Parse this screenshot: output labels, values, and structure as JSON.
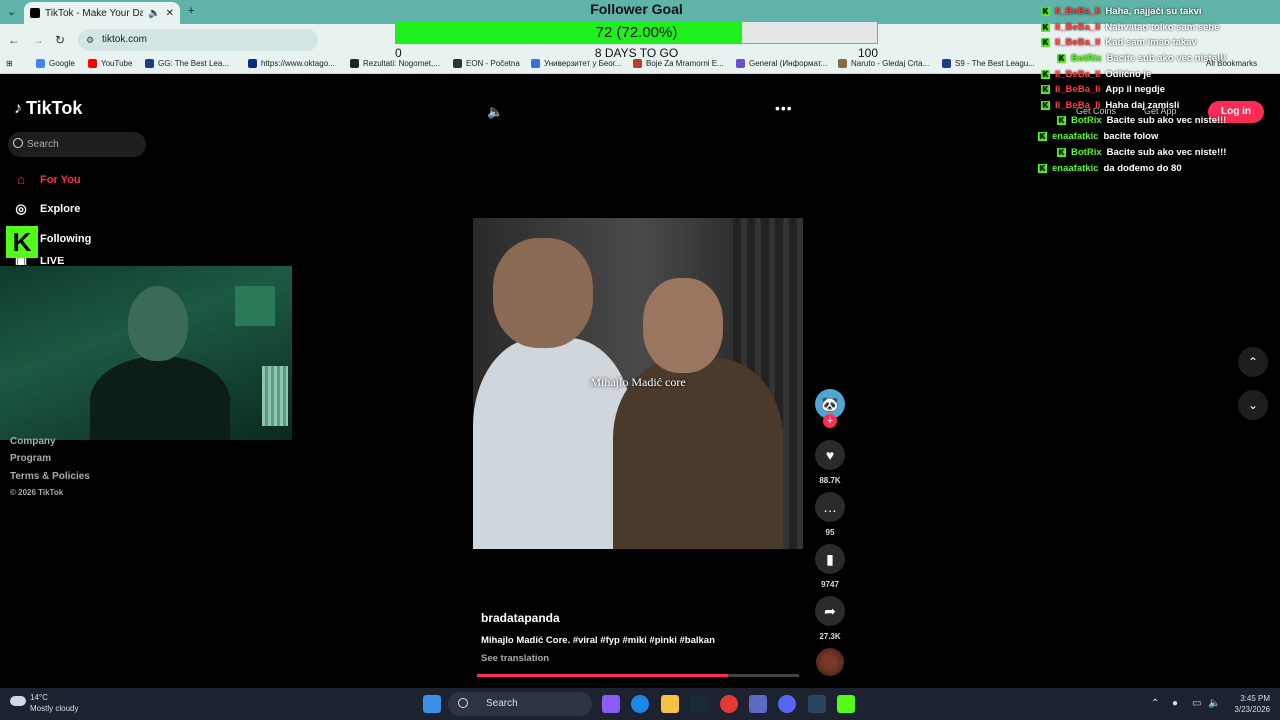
{
  "browser": {
    "tab_title": "TikTok - Make Your Day",
    "url": "tiktok.com",
    "all_bookmarks": "All Bookmarks",
    "bookmarks": [
      {
        "label": "Google",
        "color": "#4285f4"
      },
      {
        "label": "YouTube",
        "color": "#ff0000"
      },
      {
        "label": "GG: The Best Lea...",
        "color": "#1e3a8a"
      },
      {
        "label": "https://www.oktago...",
        "color": "#0a2a8a"
      },
      {
        "label": "Rezultati: Nogomet,...",
        "color": "#222222"
      },
      {
        "label": "EON - Početna",
        "color": "#333333"
      },
      {
        "label": "Универзитет у Беог...",
        "color": "#3b6fd1"
      },
      {
        "label": "Boje Za Mramorni E...",
        "color": "#c0392b"
      },
      {
        "label": "General (Информат...",
        "color": "#6b4fd1"
      },
      {
        "label": "Naruto - Gledaj Crta...",
        "color": "#8a6a3a"
      },
      {
        "label": "S9 - The Best Leagu...",
        "color": "#1e3a8a"
      }
    ]
  },
  "sidebar": {
    "logo": "TikTok",
    "search_placeholder": "Search",
    "items": [
      {
        "label": "For You",
        "icon": "home-icon",
        "active": true
      },
      {
        "label": "Explore",
        "icon": "compass-icon",
        "active": false
      },
      {
        "label": "Following",
        "icon": "users-icon",
        "active": false
      },
      {
        "label": "LIVE",
        "icon": "live-icon",
        "active": false
      }
    ],
    "footer": [
      "Company",
      "Program",
      "Terms & Policies",
      "© 2026 TikTok"
    ]
  },
  "goal": {
    "title": "Follower Goal",
    "text": "72 (72.00%)",
    "progress_percent": 72,
    "min": "0",
    "max": "100",
    "days": "8 DAYS TO GO"
  },
  "video": {
    "caption_overlay": "Mihajlo Madić core",
    "author": "bradatapanda",
    "description": "Mihajlo Madić Core. #viral #fyp #miki #pinki #balkan",
    "see_translation": "See translation",
    "likes": "88.7K",
    "comments": "95",
    "saves": "9747",
    "shares": "27.3K"
  },
  "header": {
    "get_coins": "Get Coins",
    "get_app": "Get App",
    "login": "Log in"
  },
  "chat": [
    {
      "user": "Il_BeBa_Il",
      "msg": "Haha, najjači su takvi",
      "color": "#ff3b3b"
    },
    {
      "user": "Il_BeBa_Il",
      "msg": "Nahvatao tolko sam sebe",
      "color": "#ff3b3b"
    },
    {
      "user": "Il_BeBa_Il",
      "msg": "Kad sam imao takav",
      "color": "#ff3b3b"
    },
    {
      "user": "BotRix",
      "msg": "Bacite sub ako vec niste!!!",
      "color": "#53fc18"
    },
    {
      "user": "Il_BeBa_Il",
      "msg": "Odlično je",
      "color": "#ff3b3b"
    },
    {
      "user": "Il_BeBa_Il",
      "msg": "App il negdje",
      "color": "#ff3b3b"
    },
    {
      "user": "Il_BeBa_Il",
      "msg": "Haha daj zamisli",
      "color": "#ff3b3b"
    },
    {
      "user": "BotRix",
      "msg": "Bacite sub ako vec niste!!!",
      "color": "#53fc18"
    },
    {
      "user": "enaafatkic",
      "msg": "bacite folow",
      "color": "#53fc18"
    },
    {
      "user": "BotRix",
      "msg": "Bacite sub ako vec niste!!!",
      "color": "#53fc18"
    },
    {
      "user": "enaafatkic",
      "msg": "da dođemo do 80",
      "color": "#53fc18"
    }
  ],
  "taskbar": {
    "temp": "14°C",
    "weather": "Mostly cloudy",
    "search": "Search",
    "time": "3:45 PM",
    "date": "3/23/2026"
  }
}
